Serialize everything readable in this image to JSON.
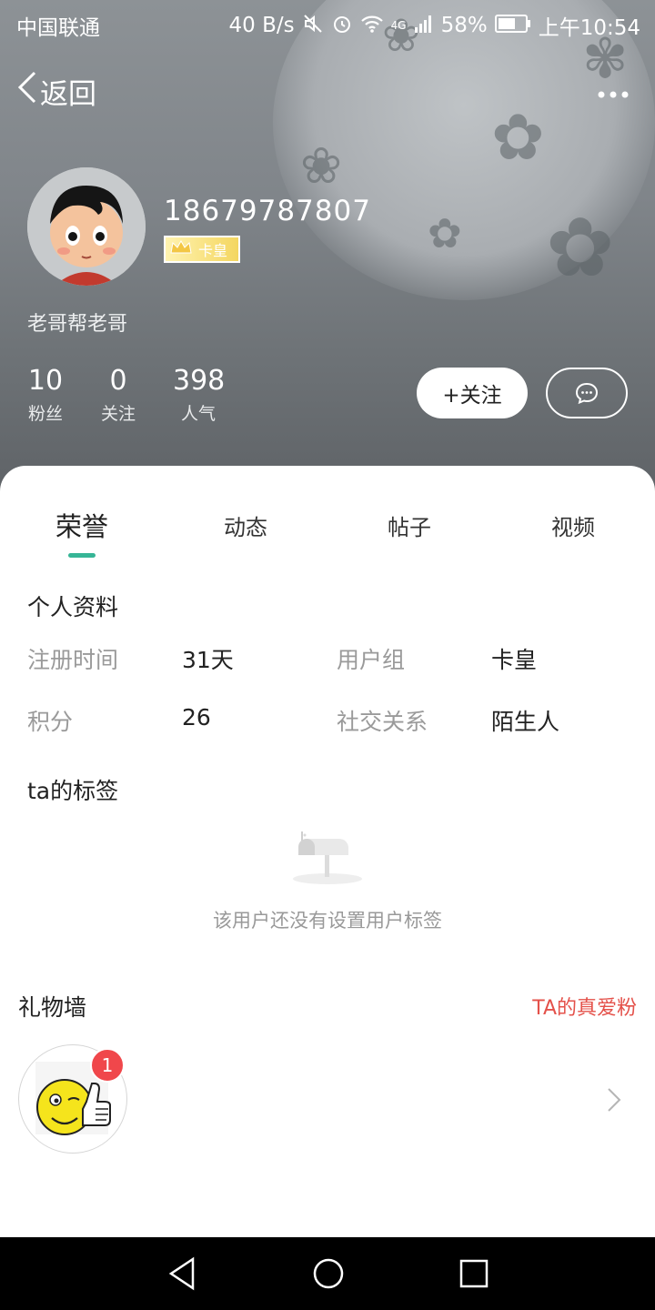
{
  "statusbar": {
    "carrier": "中国联通",
    "net_speed": "40 B/s",
    "net_type": "4G",
    "battery": "58%",
    "time": "上午10:54"
  },
  "nav": {
    "back_label": "返回"
  },
  "profile": {
    "username": "18679787807",
    "badge": "卡皇",
    "signature": "老哥帮老哥",
    "stats": [
      {
        "value": "10",
        "label": "粉丝"
      },
      {
        "value": "0",
        "label": "关注"
      },
      {
        "value": "398",
        "label": "人气"
      }
    ],
    "follow_label": "+关注"
  },
  "tabs": [
    {
      "label": "荣誉",
      "active": true
    },
    {
      "label": "动态",
      "active": false
    },
    {
      "label": "帖子",
      "active": false
    },
    {
      "label": "视频",
      "active": false
    }
  ],
  "personal_info": {
    "title": "个人资料",
    "register_label": "注册时间",
    "register_value": "31天",
    "group_label": "用户组",
    "group_value": "卡皇",
    "points_label": "积分",
    "points_value": "26",
    "relation_label": "社交关系",
    "relation_value": "陌生人"
  },
  "tags": {
    "title": "ta的标签",
    "empty_text": "该用户还没有设置用户标签"
  },
  "gifts": {
    "title": "礼物墙",
    "link": "TA的真爱粉",
    "count": "1"
  },
  "colors": {
    "accent": "#36b596",
    "link_red": "#e4514a",
    "badge_red": "#f0474b"
  }
}
